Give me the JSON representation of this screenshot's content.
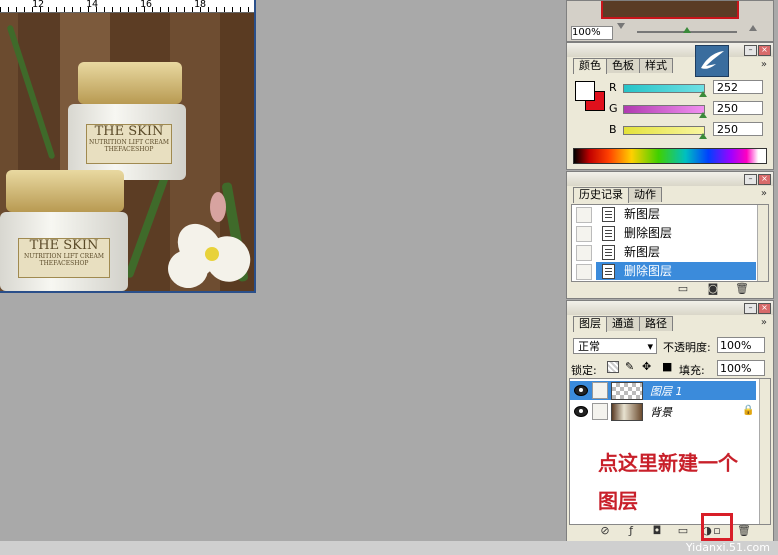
{
  "document": {
    "ruler_numbers": [
      "12",
      "14",
      "16",
      "18"
    ],
    "product_label_brand": "THE SKIN",
    "product_label_sub": "NUTRITION LIFT CREAM",
    "product_label_maker": "THEFACESHOP"
  },
  "navigator": {
    "zoom": "100%"
  },
  "color_panel": {
    "tabs": [
      "颜色",
      "色板",
      "样式"
    ],
    "channels": [
      {
        "label": "R",
        "value": "252",
        "gradient": "#27c4c8"
      },
      {
        "label": "G",
        "value": "250",
        "gradient": "#b03bb0"
      },
      {
        "label": "B",
        "value": "250",
        "gradient": "#e4e23a"
      }
    ],
    "foreground": "#ffffff",
    "background": "#e0101c"
  },
  "history_panel": {
    "tabs": [
      "历史记录",
      "动作"
    ],
    "items": [
      {
        "label": "新图层",
        "selected": false
      },
      {
        "label": "删除图层",
        "selected": false
      },
      {
        "label": "新图层",
        "selected": false
      },
      {
        "label": "删除图层",
        "selected": true
      }
    ]
  },
  "layers_panel": {
    "tabs": [
      "图层",
      "通道",
      "路径"
    ],
    "blend_mode": "正常",
    "opacity_label": "不透明度:",
    "opacity_value": "100%",
    "lock_label": "锁定:",
    "fill_label": "填充:",
    "fill_value": "100%",
    "layers": [
      {
        "name": "图层 1",
        "selected": true
      },
      {
        "name": "背景",
        "selected": false
      }
    ]
  },
  "annotation": {
    "line1": "点这里新建一个",
    "line2": "图层"
  },
  "watermark": "Yidanxi.51.com",
  "accent_color": "#3b8bdb",
  "annotation_color": "#c8202a"
}
